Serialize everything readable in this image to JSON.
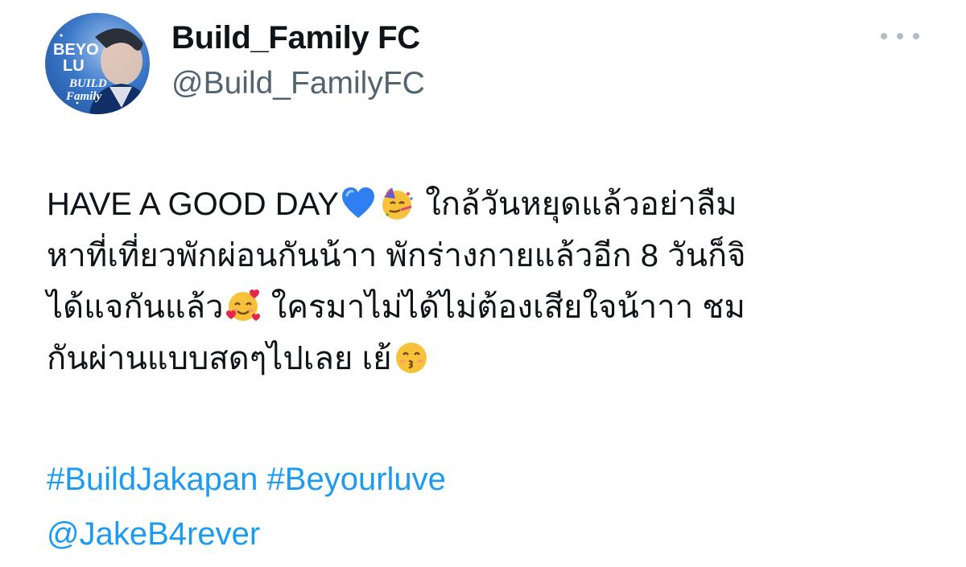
{
  "user": {
    "display_name": "Build_Family FC",
    "handle": "@Build_FamilyFC",
    "avatar_text": [
      "BEYO",
      "LU",
      "BUILD",
      "Family"
    ]
  },
  "tweet": {
    "line1_text": "HAVE A GOOD DAY",
    "line1_after": "ใกล้วันหยุดแล้วอย่าลืม",
    "line2": "หาที่เที่ยวพักผ่อนกันน้าา พักร่างกายแล้วอีก 8 วันก็จิ",
    "line3_text": "ได้แจกันแล้ว",
    "line3_after": "ใครมาไม่ได้ไม่ต้องเสียใจน้าาา ชม",
    "line4_text": "กันผ่านแบบสดๆไปเลย เย้",
    "hashtags": [
      "#BuildJakapan",
      "#Beyourluve"
    ],
    "mention": "@JakeB4rever"
  },
  "icons": {
    "more": "more-options-icon",
    "heart": "blue-heart-emoji",
    "party": "partying-face-emoji",
    "love": "smiling-face-with-hearts-emoji",
    "kiss": "kissing-face-emoji"
  },
  "colors": {
    "link": "#1d9bf0",
    "handle": "#536471",
    "text": "#0f1419"
  }
}
